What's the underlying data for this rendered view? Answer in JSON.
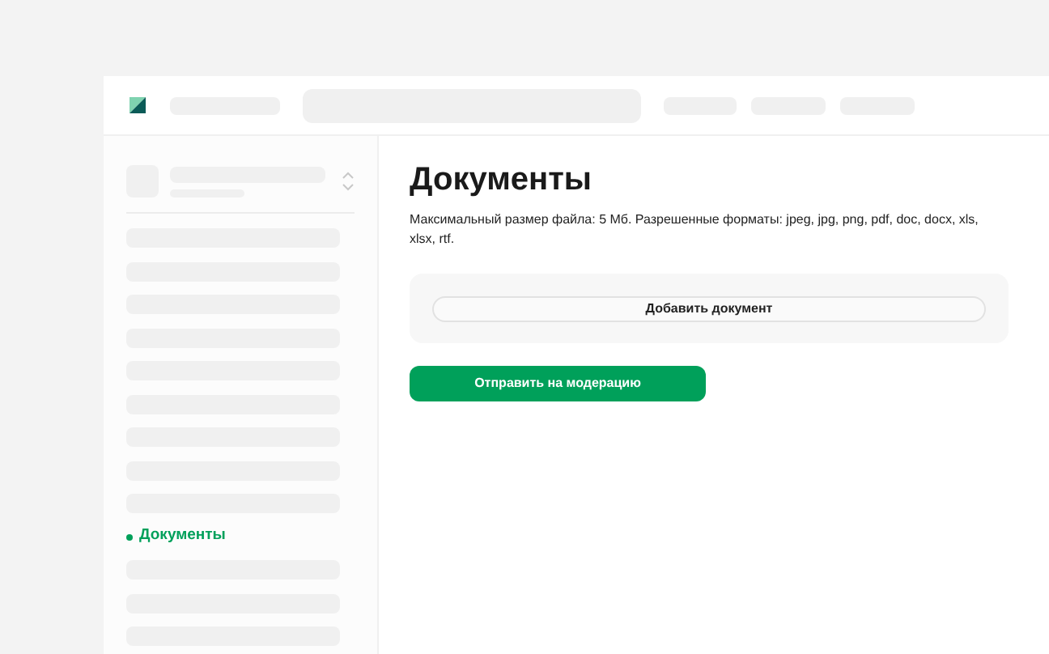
{
  "sidebar": {
    "items": [
      {
        "kind": "skeleton"
      },
      {
        "kind": "skeleton"
      },
      {
        "kind": "skeleton"
      },
      {
        "kind": "skeleton"
      },
      {
        "kind": "skeleton"
      },
      {
        "kind": "skeleton"
      },
      {
        "kind": "skeleton"
      },
      {
        "kind": "skeleton"
      },
      {
        "kind": "skeleton"
      },
      {
        "kind": "link",
        "label": "Документы",
        "selected": true
      },
      {
        "kind": "skeleton"
      },
      {
        "kind": "skeleton"
      },
      {
        "kind": "skeleton"
      }
    ]
  },
  "content": {
    "title": "Документы",
    "description": "Максимальный размер файла: 5 Мб. Разрешенные форматы: jpeg, jpg, png, pdf, doc, docx, xls, xlsx, rtf.",
    "add_button": "Добавить документ",
    "submit_button": "Отправить на модерацию"
  }
}
